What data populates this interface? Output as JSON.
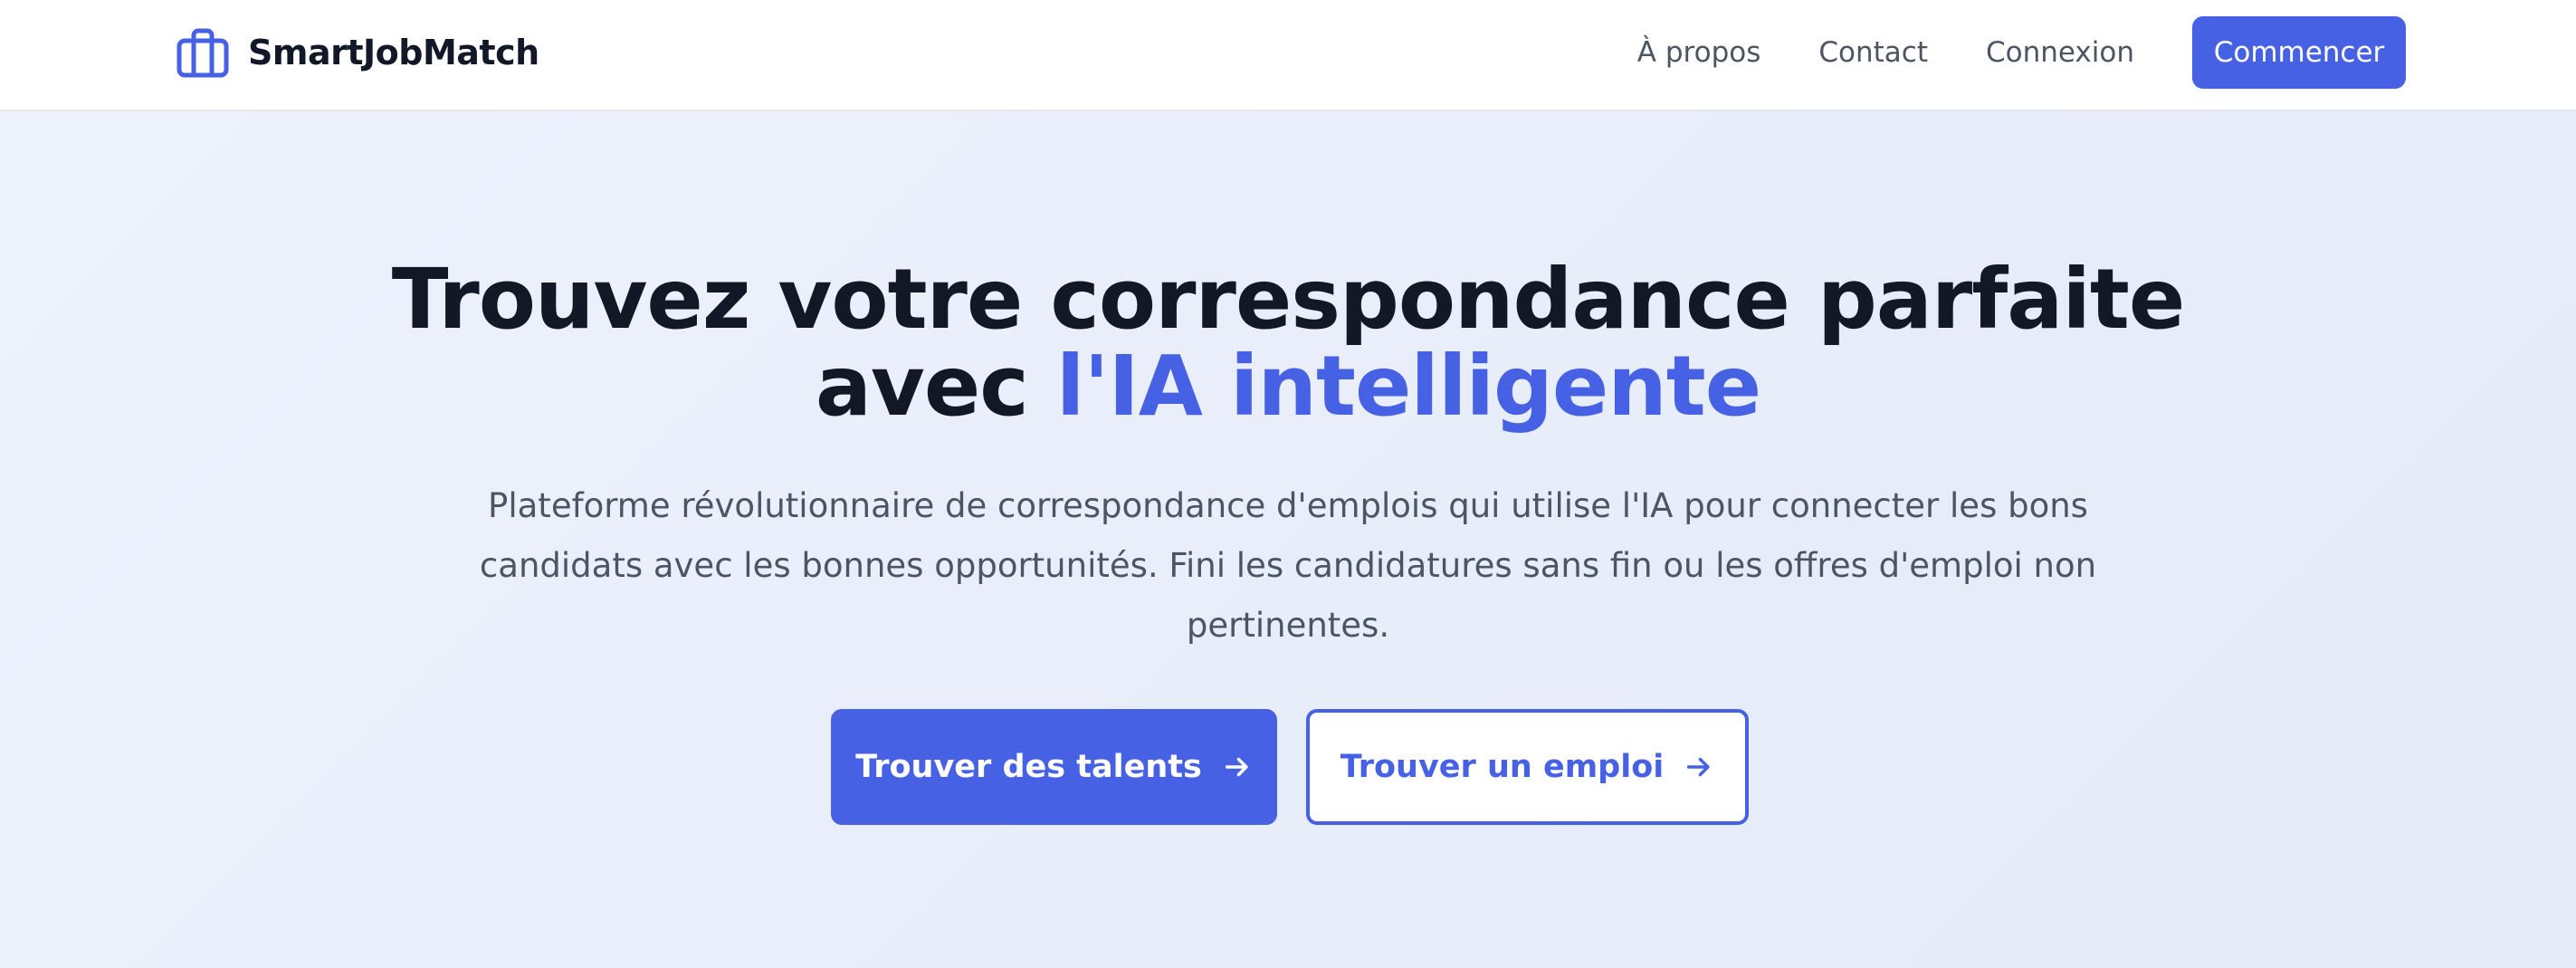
{
  "brand": {
    "name": "SmartJobMatch",
    "icon": "briefcase-icon",
    "accent_color": "#4761e4"
  },
  "nav": {
    "links": [
      "À propos",
      "Contact",
      "Connexion"
    ],
    "cta": "Commencer"
  },
  "hero": {
    "title_line1": "Trouvez votre correspondance parfaite",
    "title_line2_prefix": "avec ",
    "title_line2_accent": "l'IA intelligente",
    "subtitle": "Plateforme révolutionnaire de correspondance d'emplois qui utilise l'IA pour connecter les bons candidats avec les bonnes opportunités. Fini les candidatures sans fin ou les offres d'emploi non pertinentes.",
    "primary_button": "Trouver des talents",
    "secondary_button": "Trouver un emploi",
    "button_icon": "arrow-right-icon"
  }
}
